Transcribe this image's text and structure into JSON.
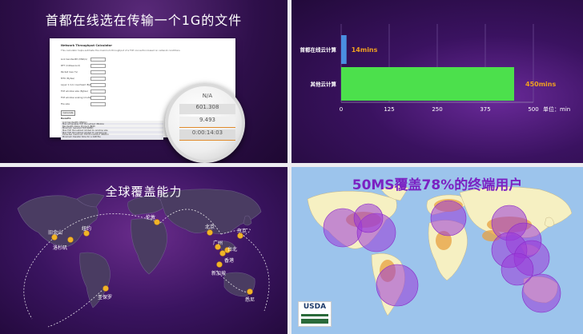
{
  "panel1": {
    "title": "首都在线选在传输一个1G的文件",
    "calculator": {
      "title": "Network Throughput Calculator",
      "description": "This calculator helps estimate the maximum throughput of a TCP connection based on network conditions",
      "fields": [
        {
          "label": "Link bandwidth (Mbit/s)"
        },
        {
          "label": "RTT (millisecond)"
        },
        {
          "label": "Packet loss (%)"
        },
        {
          "label": "MTU (Bytes)"
        },
        {
          "label": "Layer 1 (L1) overhead (Bytes)"
        },
        {
          "label": "TCP window size (Bytes)"
        },
        {
          "label": "TCP window scaling (multiple)"
        },
        {
          "label": "File size"
        }
      ],
      "button_label": "Calculate",
      "results_title": "Results",
      "results": [
        {
          "label": "Link bandwidth (Mbit/s)"
        },
        {
          "label": "Max achievable TCP throughput (Mbit/s)"
        },
        {
          "label": "Bandwidth-Delay Product (BDP)"
        },
        {
          "label": "Minimum required TCP RWND"
        },
        {
          "label": "Max TCP throughput limited by window size"
        },
        {
          "label": "Max TCP throughput limited by packet loss"
        },
        {
          "label": "Expected maximum TCP throughput (Mbit/s)"
        },
        {
          "label": "Minimum transfer time for a 1GB file"
        }
      ]
    },
    "magnifier": {
      "values": [
        "N/A",
        "601.308",
        "9.493",
        "0:00:14:03"
      ]
    }
  },
  "panel2": {
    "chart_data": {
      "type": "bar",
      "orientation": "horizontal",
      "categories": [
        "首都在线云计算",
        "其他云计算"
      ],
      "values": [
        14,
        450
      ],
      "value_labels": [
        "14mins",
        "450mins"
      ],
      "xlim": [
        0,
        500
      ],
      "xticks": [
        0,
        125,
        250,
        375,
        500
      ],
      "unit_label": "单位：min",
      "colors": [
        "#4a8ee0",
        "#4ce04c"
      ],
      "label_color": "#f0a020"
    }
  },
  "panel3": {
    "title": "全球覆盖能力",
    "cities": [
      "旧金山",
      "洛杉矶",
      "纽约",
      "伦敦",
      "法兰克福",
      "圣保罗",
      "北京",
      "上海",
      "广州",
      "深圳",
      "香港",
      "台北",
      "东京",
      "新加坡",
      "悉尼"
    ]
  },
  "panel4": {
    "title": "50MS覆盖78%的终端用户",
    "logo_text": "USDA",
    "colors": {
      "ocean": "#9cc4ec",
      "land": "#f6f0c2",
      "coverage": "#9a38d8"
    }
  }
}
